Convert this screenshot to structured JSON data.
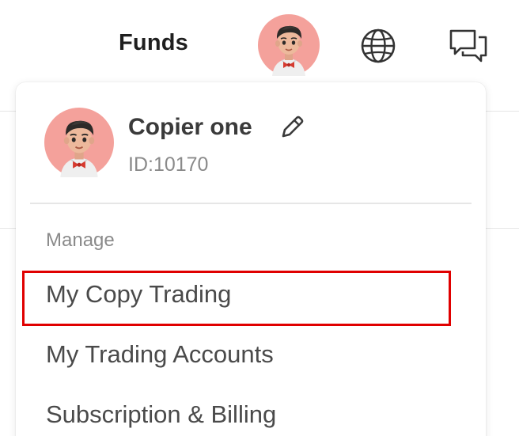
{
  "header": {
    "funds_label": "Funds",
    "icons": {
      "avatar": "user-avatar",
      "language": "globe-icon",
      "messages": "chat-icon"
    }
  },
  "profile": {
    "name": "Copier one",
    "id_label": "ID:10170",
    "avatar_background": "#f4a19b"
  },
  "menu": {
    "section_label": "Manage",
    "items": [
      {
        "label": "My Copy Trading",
        "highlighted": true
      },
      {
        "label": "My Trading Accounts"
      },
      {
        "label": "Subscription & Billing"
      }
    ]
  },
  "colors": {
    "highlight_border": "#e00000",
    "text_primary": "#1f1f1f",
    "text_secondary": "#8a8a8a",
    "avatar_bg": "#f4a19b"
  }
}
